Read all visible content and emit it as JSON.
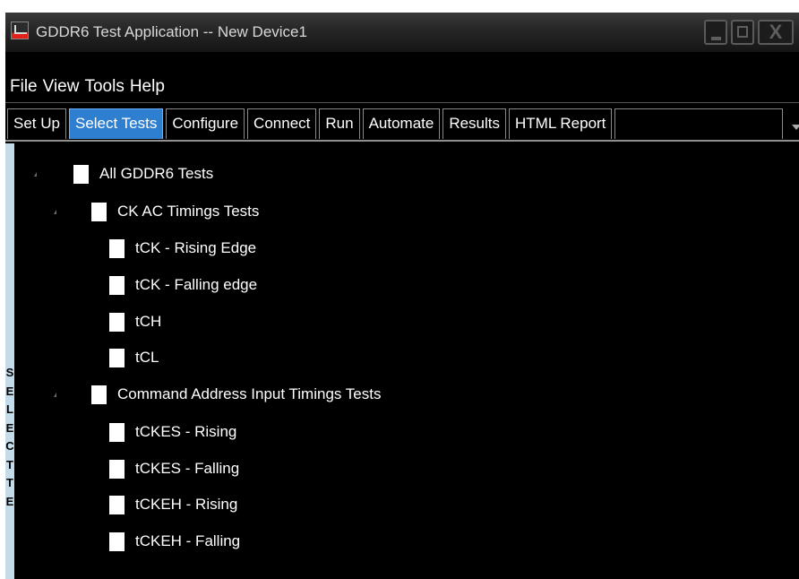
{
  "window": {
    "title": "GDDR6 Test Application -- New Device1",
    "icon": "app-logo-icon",
    "controls": [
      "minimize-icon",
      "maximize-icon",
      "close-icon"
    ],
    "close_glyph": "X"
  },
  "menu": {
    "items": [
      {
        "id": "file",
        "label": "File"
      },
      {
        "id": "view",
        "label": "View"
      },
      {
        "id": "tools",
        "label": "Tools"
      },
      {
        "id": "help",
        "label": "Help"
      }
    ]
  },
  "tabs": {
    "items": [
      {
        "id": "set-up",
        "label": "Set Up",
        "active": false
      },
      {
        "id": "select-tests",
        "label": "Select Tests",
        "active": true
      },
      {
        "id": "configure",
        "label": "Configure",
        "active": false
      },
      {
        "id": "connect",
        "label": "Connect",
        "active": false
      },
      {
        "id": "run",
        "label": "Run",
        "active": false
      },
      {
        "id": "automate",
        "label": "Automate",
        "active": false
      },
      {
        "id": "results",
        "label": "Results",
        "active": false
      },
      {
        "id": "html-report",
        "label": "HTML Report",
        "active": false
      }
    ],
    "active_color": "#2f7fd1"
  },
  "sidebar": {
    "label": "SELECT TE",
    "background": "#c4dbe9"
  },
  "tree": {
    "root": {
      "label": "All GDDR6 Tests",
      "checked": false,
      "expanded": true
    },
    "groups": [
      {
        "id": "ck-ac",
        "label": "CK AC Timings Tests",
        "checked": false,
        "expanded": true,
        "tests": [
          {
            "label": "tCK - Rising Edge",
            "checked": false
          },
          {
            "label": "tCK - Falling edge",
            "checked": false
          },
          {
            "label": "tCH",
            "checked": false
          },
          {
            "label": "tCL",
            "checked": false
          }
        ]
      },
      {
        "id": "cmd-addr",
        "label": "Command Address Input Timings Tests",
        "checked": false,
        "expanded": true,
        "tests": [
          {
            "label": "tCKES - Rising",
            "checked": false
          },
          {
            "label": "tCKES - Falling",
            "checked": false
          },
          {
            "label": "tCKEH - Rising",
            "checked": false
          },
          {
            "label": "tCKEH - Falling",
            "checked": false
          }
        ]
      }
    ]
  }
}
